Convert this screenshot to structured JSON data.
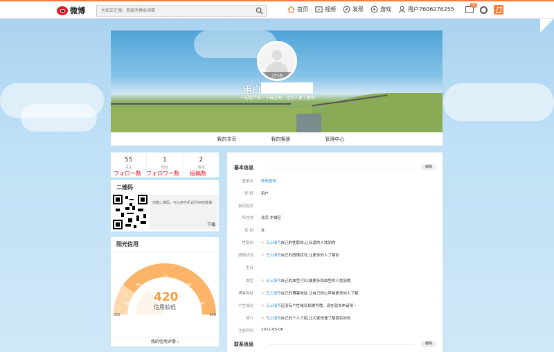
{
  "topbar": {
    "logo_text": "微博",
    "search_placeholder": "大家正在搜：首届消博会闭幕",
    "nav": [
      {
        "label": "首页",
        "icon": "home-icon"
      },
      {
        "label": "视频",
        "icon": "video-icon"
      },
      {
        "label": "发现",
        "icon": "discover-icon"
      },
      {
        "label": "游戏",
        "icon": "game-icon"
      },
      {
        "label": "用户7606276255",
        "icon": "user-icon"
      }
    ],
    "mail_badge": "32"
  },
  "profile": {
    "avatar_caption": "上传头像",
    "username": "用户",
    "intro": "一句话介绍一下自己吧，让别人更了解你"
  },
  "tabs": [
    "我的主页",
    "我的相册",
    "管理中心"
  ],
  "stats": [
    {
      "count": "55",
      "label": "关注"
    },
    {
      "count": "1",
      "label": "粉丝"
    },
    {
      "count": "2",
      "label": "微博"
    }
  ],
  "annotations": [
    "フォロー数",
    "フォロワー数",
    "投稿数"
  ],
  "qr": {
    "title": "二维码",
    "text": "扫描二维码，可以用手机访问TA的微博",
    "download": "下载"
  },
  "credit": {
    "title": "阳光信用",
    "score": "420",
    "level": "信用较低",
    "min": "300",
    "max": "900",
    "segments": [
      "较差",
      "较低",
      "一般",
      "较好",
      "极好"
    ],
    "footer": "我的信用评情 ›"
  },
  "basic_info": {
    "title": "基本信息",
    "edit": "编辑",
    "rows": [
      {
        "label": "登录名",
        "value": "修改密码",
        "style": "blue"
      },
      {
        "label": "昵 称",
        "value": "用户"
      },
      {
        "label": "真实姓名",
        "value": ""
      },
      {
        "label": "所在地",
        "value": "北京 东城区"
      },
      {
        "label": "性 别",
        "value": "女"
      },
      {
        "label": "性取向",
        "link": "马上填写",
        "value": "自己的性取向,让合适的人找到你"
      },
      {
        "label": "感情状况",
        "link": "马上填写",
        "value": "自己的感情状况,让更多的人了解你"
      },
      {
        "label": "生日",
        "value": ""
      },
      {
        "label": "血型",
        "link": "马上填写",
        "value": "自己的血型,可以被更多同血型的人找到哦"
      },
      {
        "label": "博客地址",
        "link": "马上填写",
        "value": "自己的博客地址,让自己的心声被更多的人了解"
      },
      {
        "label": "个性域名",
        "link": "马上填写",
        "value": "还没有个性域名和微号哦，现在就去申请吧~"
      },
      {
        "label": "简介",
        "link": "马上填写",
        "value": "自己的个人介绍,让大家快速了解真实的你"
      },
      {
        "label": "注册时间",
        "value": "2021-05-06"
      }
    ]
  },
  "contact_info": {
    "title": "联系信息",
    "edit": "编辑"
  },
  "colors": {
    "brand_orange": "#fa7d3c",
    "weibo_red": "#e6162d",
    "link_orange": "#eb7350",
    "gauge": "#fbb468"
  }
}
